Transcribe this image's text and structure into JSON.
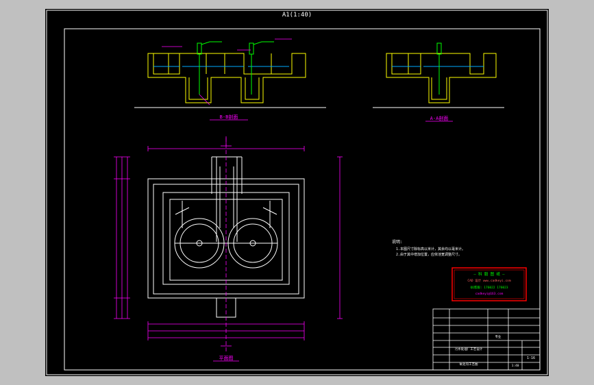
{
  "drawing": {
    "window_title": "A1(1:40)",
    "section_b_label": "B-B剖面",
    "section_a_label": "A-A剖面",
    "plan_label": "平面图",
    "notes_title": "说明:",
    "note_1": "1.本图尺寸除标高以米计，其余均以毫米计。",
    "note_2": "2.由于其中增加位置，应依池宽调整尺寸。",
    "stamp_line_1": "—  科 毅 图 纸  —",
    "stamp_line_2": "CAD 设计 www.cadkeyi.com",
    "stamp_line_3": "QQ客服: 176022 176023",
    "stamp_line_4": "cadkeyi@163.com",
    "title_block_project": "污水处理厂工艺设计",
    "title_block_drawing": "氧化沟工艺图",
    "title_block_sheet": "1-16",
    "title_block_dept": "专业",
    "title_block_scale": "1:40"
  },
  "colors": {
    "background": "#000000",
    "frame": "#ffffff",
    "structure": "#ffff00",
    "dimension": "#ff00ff",
    "pipe": "#00ff00",
    "water": "#00aaff",
    "stamp_border": "#ff0000",
    "stamp_text": "#00ff00"
  }
}
